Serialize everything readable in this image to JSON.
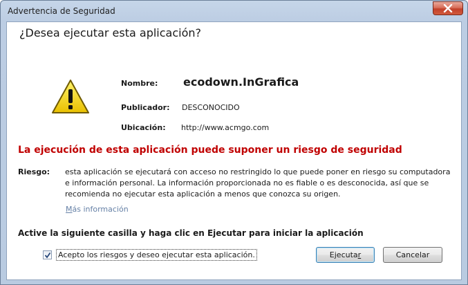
{
  "window": {
    "title": "Advertencia de Seguridad",
    "close_icon": "close-x-icon"
  },
  "dialog": {
    "heading": "¿Desea ejecutar esta aplicación?",
    "warning_icon": "warning-triangle-icon",
    "fields": {
      "name_label": "Nombre:",
      "name_value": "ecodown.InGrafica",
      "publisher_label": "Publicador:",
      "publisher_value": "DESCONOCIDO",
      "location_label": "Ubicación:",
      "location_value": "http://www.acmgo.com"
    },
    "risk_headline": "La ejecución de esta aplicación puede suponer un riesgo de seguridad",
    "risk_label": "Riesgo:",
    "risk_text": "esta aplicación se ejecutará con acceso no restringido lo que puede poner en riesgo su computadora e información personal. La información proporcionada no es fiable o es desconocida, así que se recomienda no ejecutar esta aplicación a menos que conozca su origen.",
    "more_info_prefix": "M",
    "more_info_rest": "ás información",
    "action_text": "Active la siguiente casilla y haga clic en Ejecutar para iniciar la aplicación",
    "checkbox": {
      "checked": true,
      "label": "Acepto los riesgos y deseo ejecutar esta aplicación."
    },
    "buttons": {
      "run_label_main": "Ejecuta",
      "run_label_underlined": "r",
      "cancel_label": "Cancelar"
    }
  },
  "colors": {
    "risk_headline": "#c00000",
    "link": "#6580a6",
    "warning_fill": "#f5d000"
  }
}
